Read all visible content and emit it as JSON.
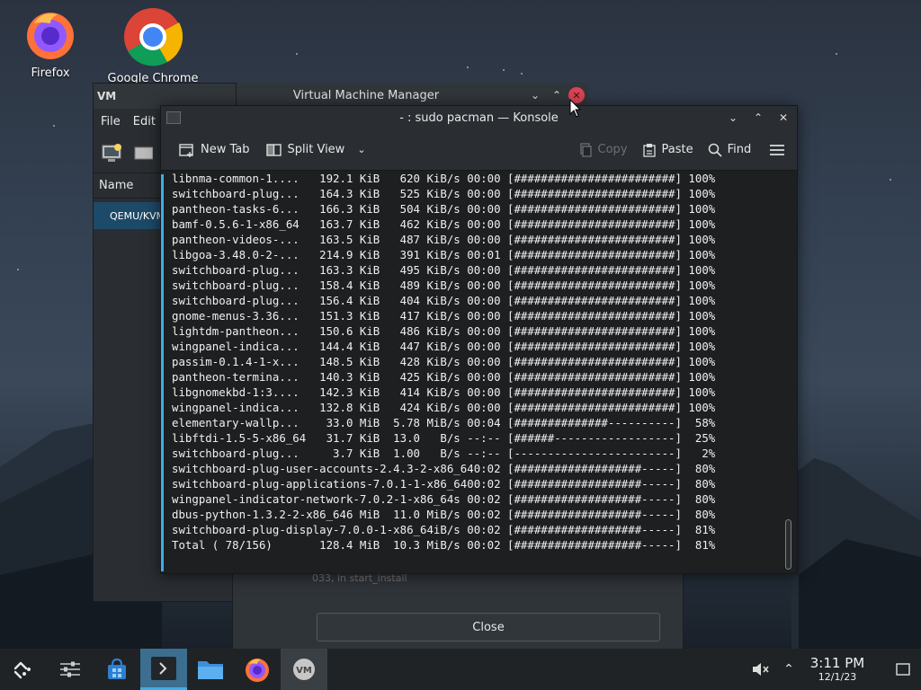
{
  "desktop": {
    "icons": [
      {
        "label": "Firefox"
      },
      {
        "label": "Google Chrome"
      }
    ]
  },
  "vmm": {
    "title": "Virtual Machine Manager",
    "menu": [
      "File",
      "Edit"
    ],
    "column_header": "Name",
    "row": "QEMU/KVM"
  },
  "dialog": {
    "text": "033, in start_install",
    "close_label": "Close"
  },
  "konsole": {
    "title": "- : sudo pacman — Konsole",
    "toolbar": {
      "new_tab": "New Tab",
      "split_view": "Split View",
      "copy": "Copy",
      "paste": "Paste",
      "find": "Find"
    },
    "lines": [
      "libnma-common-1....   192.1 KiB   620 KiB/s 00:00 [########################] 100%",
      "switchboard-plug...   164.3 KiB   525 KiB/s 00:00 [########################] 100%",
      "pantheon-tasks-6...   166.3 KiB   504 KiB/s 00:00 [########################] 100%",
      "bamf-0.5.6-1-x86_64   163.7 KiB   462 KiB/s 00:00 [########################] 100%",
      "pantheon-videos-...   163.5 KiB   487 KiB/s 00:00 [########################] 100%",
      "libgoa-3.48.0-2-...   214.9 KiB   391 KiB/s 00:01 [########################] 100%",
      "switchboard-plug...   163.3 KiB   495 KiB/s 00:00 [########################] 100%",
      "switchboard-plug...   158.4 KiB   489 KiB/s 00:00 [########################] 100%",
      "switchboard-plug...   156.4 KiB   404 KiB/s 00:00 [########################] 100%",
      "gnome-menus-3.36...   151.3 KiB   417 KiB/s 00:00 [########################] 100%",
      "lightdm-pantheon...   150.6 KiB   486 KiB/s 00:00 [########################] 100%",
      "wingpanel-indica...   144.4 KiB   447 KiB/s 00:00 [########################] 100%",
      "passim-0.1.4-1-x...   148.5 KiB   428 KiB/s 00:00 [########################] 100%",
      "pantheon-termina...   140.3 KiB   425 KiB/s 00:00 [########################] 100%",
      "libgnomekbd-1:3....   142.3 KiB   414 KiB/s 00:00 [########################] 100%",
      "wingpanel-indica...   132.8 KiB   424 KiB/s 00:00 [########################] 100%",
      "elementary-wallp...    33.0 MiB  5.78 MiB/s 00:04 [##############----------]  58%",
      "libftdi-1.5-5-x86_64   31.7 KiB  13.0   B/s --:-- [######------------------]  25%",
      "switchboard-plug...     3.7 KiB  1.00   B/s --:-- [------------------------]   2%",
      "switchboard-plug-user-accounts-2.4.3-2-x86_640:02 [###################-----]  80%",
      "switchboard-plug-applications-7.0.1-1-x86_6400:02 [###################-----]  80%",
      "wingpanel-indicator-network-7.0.2-1-x86_64s 00:02 [###################-----]  80%",
      "dbus-python-1.3.2-2-x86_646 MiB  11.0 MiB/s 00:02 [###################-----]  80%",
      "switchboard-plug-display-7.0.0-1-x86_64iB/s 00:02 [###################-----]  81%",
      "Total ( 78/156)       128.4 MiB  10.3 MiB/s 00:02 [###################-----]  81%"
    ]
  },
  "taskbar": {
    "clock_time": "3:11 PM",
    "clock_date": "12/1/23"
  },
  "colors": {
    "accent": "#3daee9",
    "close_red": "#da4453",
    "panel_bg": "#1f2326",
    "terminal_bg": "#1e1f21"
  }
}
